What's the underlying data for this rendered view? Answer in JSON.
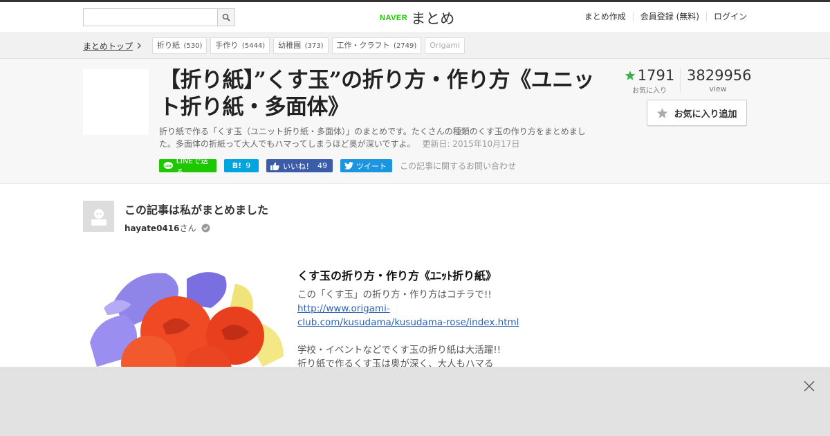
{
  "header": {
    "search": {
      "value": "",
      "placeholder": ""
    },
    "logo": {
      "brand": "NAVER",
      "name": "まとめ"
    },
    "nav": [
      "まとめ作成",
      "会員登録 (無料)",
      "ログイン"
    ]
  },
  "breadcrumb": {
    "top_label": "まとめトップ",
    "tags": [
      {
        "label": "折り紙",
        "count": "(530)"
      },
      {
        "label": "手作り",
        "count": "(5444)"
      },
      {
        "label": "幼稚園",
        "count": "(373)"
      },
      {
        "label": "工作・クラフト",
        "count": "(2749)"
      },
      {
        "label": "Origami",
        "count": ""
      }
    ]
  },
  "article": {
    "title": "【折り紙】”くす玉”の折り方・作り方《ユニット折り紙・多面体》",
    "description": "折り紙で作る「くす玉（ユニット折り紙・多面体）」のまとめです。たくさんの種類のくす玉の作り方をまとめました。多面体の折紙って大人でもハマってしまうほど奥が深いですよ。",
    "updated": "更新日: 2015年10月17日",
    "share": {
      "line": "LINEで送る",
      "hatena": "B!",
      "hatena_count": "9",
      "facebook": "いいね！",
      "facebook_count": "49",
      "twitter": "ツイート",
      "inquiry": "この記事に関するお問い合わせ"
    },
    "stats": {
      "favorites": "1791",
      "favorites_label": "お気に入り",
      "views": "3829956",
      "views_label": "view",
      "add_favorite": "お気に入り追加"
    }
  },
  "author": {
    "heading": "この記事は私がまとめました",
    "username": "hayate0416",
    "suffix": "さん"
  },
  "item": {
    "heading": "くす玉の折り方・作り方《ﾕﾆｯﾄ折り紙》",
    "line1": "この「くす玉」の折り方・作り方はコチラで!!",
    "link": "http://www.origami-club.com/kusudama/kusudama-rose/index.html",
    "line2": "学校・イベントなどでくす玉の折り紙は大活躍!!",
    "line3": "折り紙で作るくす玉は奥が深く、大人もハマる"
  },
  "colors": {
    "naver_green": "#1ec800",
    "line": "#1ec800",
    "hatena": "#00a4de",
    "facebook": "#3b5ca8",
    "twitter": "#1b95e0",
    "link": "#2b62b7"
  }
}
